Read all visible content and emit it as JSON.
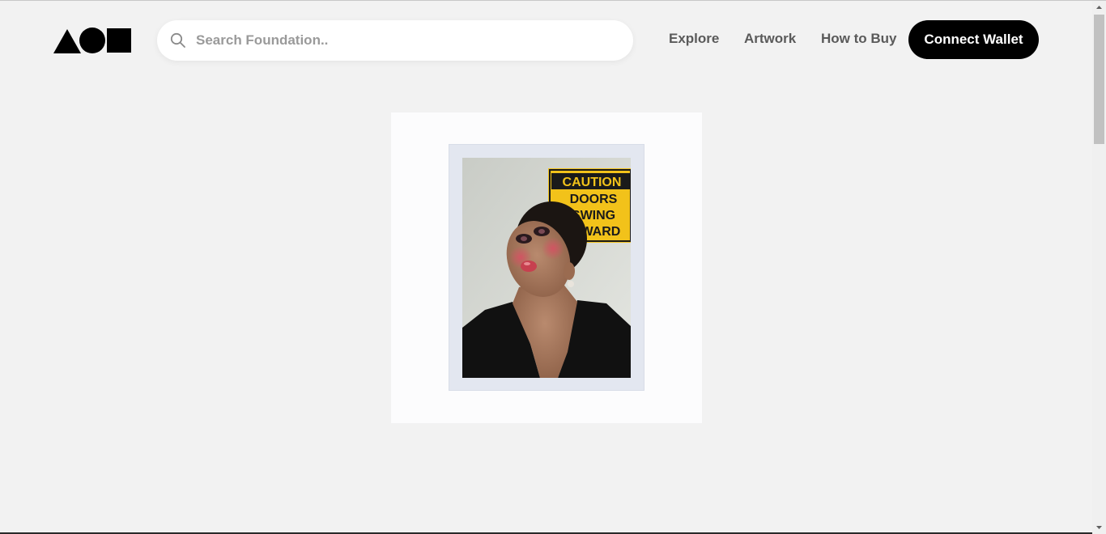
{
  "header": {
    "logo_name": "foundation-logo",
    "search": {
      "placeholder": "Search Foundation..",
      "value": ""
    },
    "nav": [
      {
        "label": "Explore"
      },
      {
        "label": "Artwork"
      },
      {
        "label": "How to Buy"
      }
    ],
    "connect_label": "Connect Wallet"
  },
  "artwork": {
    "icon": "polaroid-portrait",
    "sign": {
      "line1": "CAUTION",
      "line2": "DOORS",
      "line3": "SWING",
      "line4": "TWARD"
    }
  },
  "colors": {
    "background": "#f2f2f2",
    "button": "#000000",
    "nav_text": "#5a5a5a",
    "sign_yellow": "#f2c21a"
  }
}
